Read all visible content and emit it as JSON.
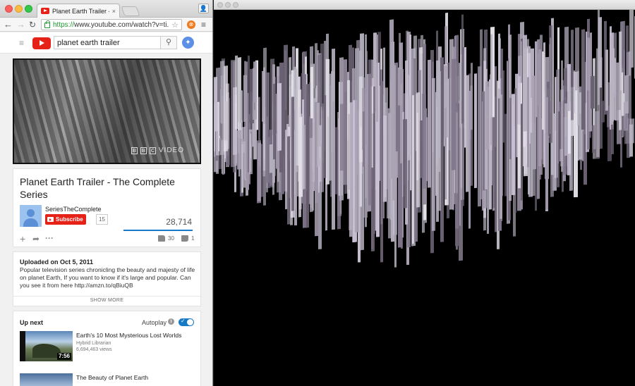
{
  "browser": {
    "tab_title": "Planet Earth Trailer - Th",
    "tab_close": "×",
    "url_scheme": "https://",
    "url_rest": "www.youtube.com/watch?v=ti..."
  },
  "youtube": {
    "search_value": "planet earth trailer",
    "video": {
      "title": "Planet Earth Trailer - The Complete Series",
      "watermark_boxes": [
        "B",
        "B",
        "C"
      ],
      "watermark_text": "VIDEO"
    },
    "channel": {
      "name": "SeriesTheComplete",
      "subscribe_label": "Subscribe",
      "subscriber_count": "15"
    },
    "stats": {
      "views": "28,714",
      "likes": "30",
      "dislikes": "1",
      "like_ratio": 0.97
    },
    "description": {
      "uploaded": "Uploaded on Oct 5, 2011",
      "text": "Popular television series chronicling the beauty and majesty of life on planet Earth, If you want to know if it's large and popular. Can you see it from here http://amzn.to/qBiuQB",
      "show_more": "SHOW MORE"
    },
    "up_next": {
      "label": "Up next",
      "autoplay_label": "Autoplay",
      "autoplay_on": true,
      "items": [
        {
          "title": "Earth's 10 Most Mysterious Lost Worlds",
          "channel": "Hybrid Librarian",
          "views": "6,694,463 views",
          "duration": "7:56"
        },
        {
          "title": "The Beauty of Planet Earth",
          "channel": "",
          "views": "",
          "duration": ""
        }
      ]
    }
  },
  "colors": {
    "youtube_red": "#e62117",
    "link_blue": "#167ac6",
    "viz_background": "#000000",
    "viz_bar_palette": [
      "#c9c2d4",
      "#9e95a8",
      "#7d7488",
      "#b8b3c0",
      "#e3e0e8",
      "#6a6272",
      "#a9a2b3"
    ]
  },
  "icons": {
    "back": "arrow-left-icon",
    "forward": "arrow-right-icon",
    "reload": "reload-icon",
    "lock": "lock-icon",
    "star": "star-icon",
    "menu": "hamburger-menu-icon",
    "search": "search-icon",
    "add": "plus-icon",
    "share": "share-arrow-icon",
    "more": "ellipsis-icon",
    "like": "thumbs-up-icon",
    "dislike": "thumbs-down-icon",
    "info": "info-icon"
  }
}
